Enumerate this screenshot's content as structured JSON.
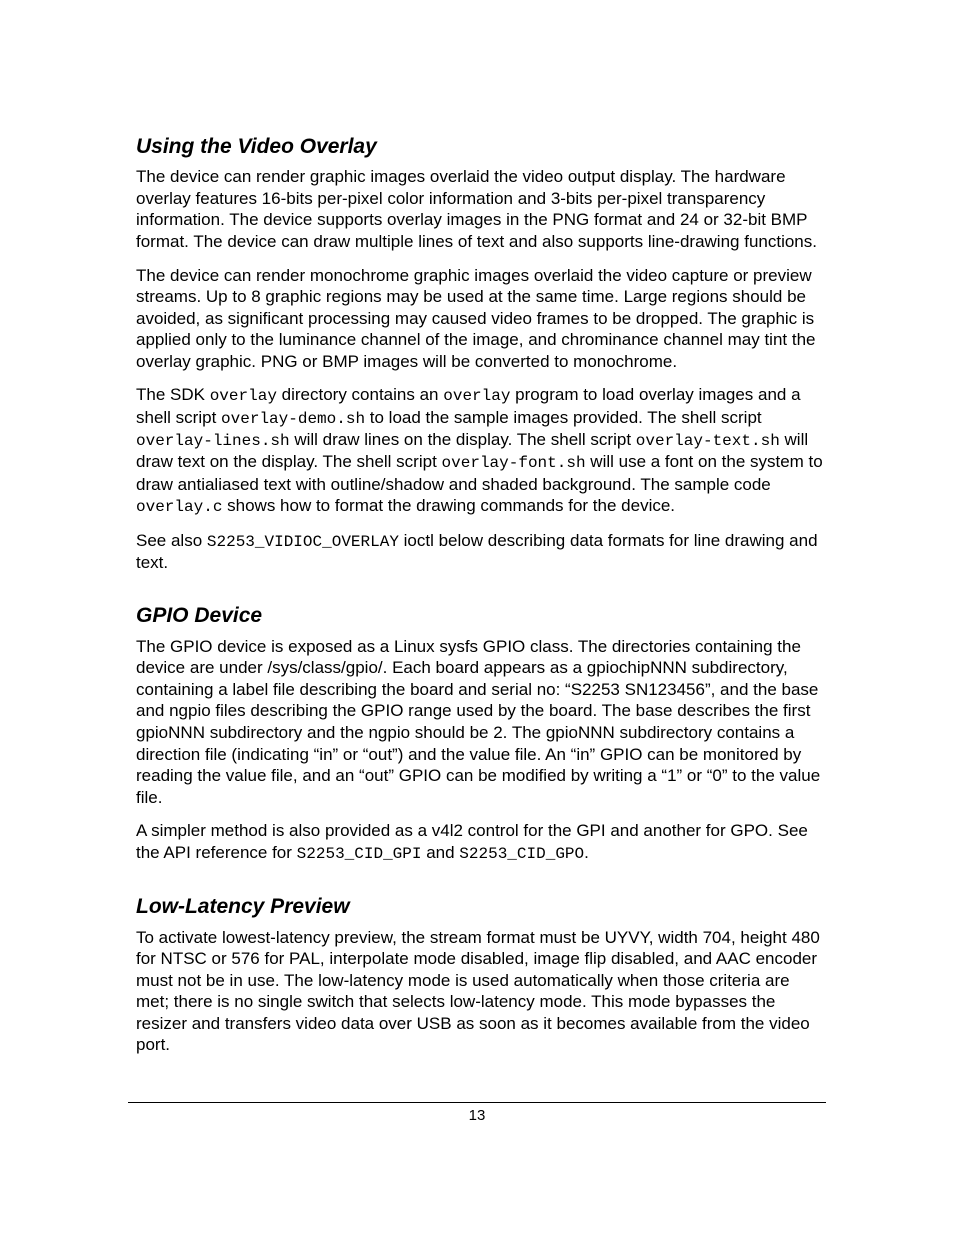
{
  "sections": {
    "overlay": {
      "heading": "Using the Video Overlay",
      "p1": "The device can render graphic images overlaid the video output display. The hardware overlay features 16-bits per-pixel color information and 3-bits per-pixel transparency information. The device supports overlay images in the PNG format and 24 or 32-bit BMP format. The device can draw multiple lines of text and also supports line-drawing functions.",
      "p2": "The device can render monochrome graphic images overlaid the video capture or preview streams. Up to 8 graphic regions may be used at the same time. Large regions should be avoided, as significant processing may caused video frames to be dropped. The graphic is applied only to the luminance channel of the image, and chrominance channel may tint the overlay graphic. PNG or BMP images will be converted to monochrome.",
      "p3a": "The SDK ",
      "p3_code1": "overlay",
      "p3b": " directory contains an ",
      "p3_code2": "overlay",
      "p3c": " program to load overlay images and a shell script ",
      "p3_code3": "overlay-demo.sh",
      "p3d": " to load the sample images provided. The shell script ",
      "p3_code4": "overlay-lines.sh",
      "p3e": " will draw lines on the display. The shell script ",
      "p3_code5": "overlay-text.sh",
      "p3f": " will draw text on the display. The shell script ",
      "p3_code6": "overlay-font.sh",
      "p3g": " will use a font on the system to draw antialiased text with outline/shadow and shaded background. The sample code ",
      "p3_code7": "overlay.c",
      "p3h": " shows how to format the drawing commands for the device.",
      "p4a": "See also ",
      "p4_code1": "S2253_VIDIOC_OVERLAY",
      "p4b": " ioctl below describing data formats for line drawing and text."
    },
    "gpio": {
      "heading": "GPIO Device",
      "p1": "The GPIO device is exposed as a Linux sysfs GPIO class. The directories containing the device are under /sys/class/gpio/. Each board appears as a gpiochipNNN subdirectory, containing a label file describing the board and serial no: “S2253 SN123456”, and the base and ngpio files describing the GPIO range used by the board. The base describes the first gpioNNN subdirectory and the ngpio should be 2.  The gpioNNN subdirectory contains a direction file (indicating “in” or “out”) and the value file. An “in” GPIO can be monitored by reading the value file, and an “out” GPIO can be modified by writing a “1” or “0” to the value file.",
      "p2a": "A simpler method is also provided as a v4l2 control for the GPI and another for GPO. See the API reference for ",
      "p2_code1": "S2253_CID_GPI",
      "p2b": " and ",
      "p2_code2": "S2253_CID_GPO",
      "p2c": "."
    },
    "lowlat": {
      "heading": "Low-Latency Preview",
      "p1": "To activate lowest-latency preview, the stream format must be UYVY, width 704, height 480 for NTSC or 576 for PAL, interpolate mode disabled, image flip disabled, and AAC encoder must not be in use. The low-latency mode is used automatically when those criteria are met; there is no single switch that selects low-latency mode. This mode bypasses the resizer and transfers video data over USB as soon as it becomes available from the video port."
    }
  },
  "page_number": "13"
}
